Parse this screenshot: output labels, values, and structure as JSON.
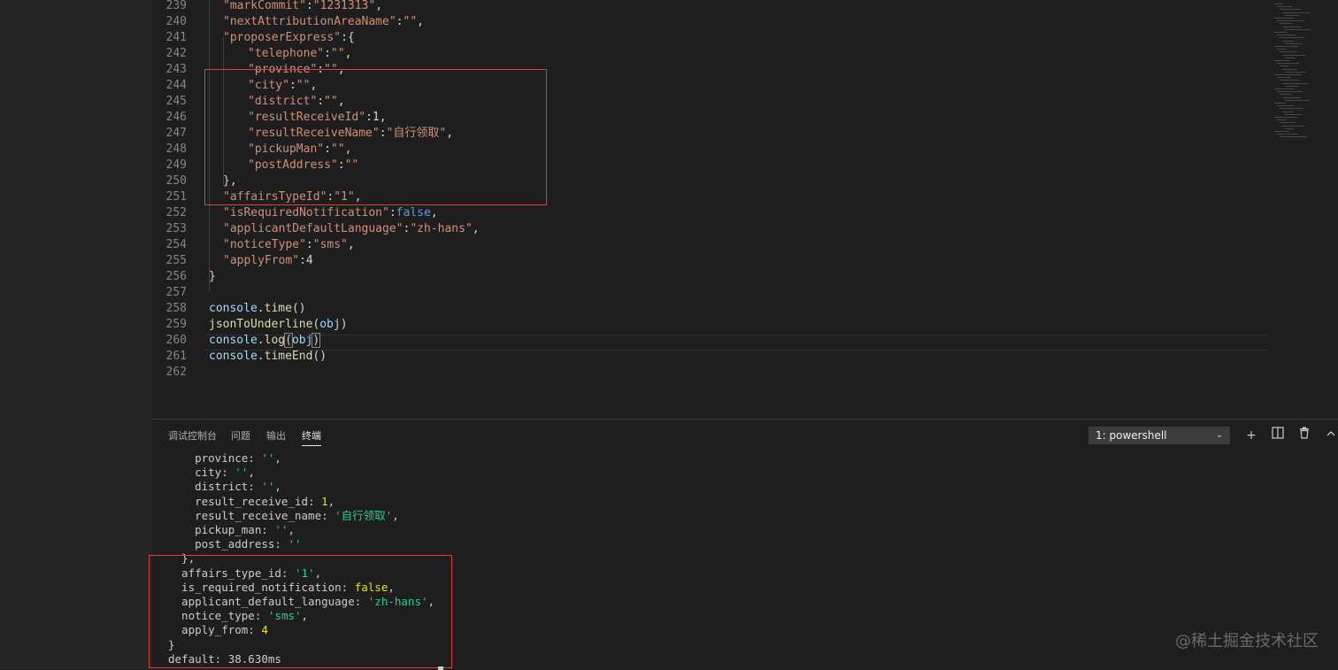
{
  "editor": {
    "lines": [
      {
        "num": "239",
        "tokens": [
          [
            "k",
            "\"markCommit\""
          ],
          [
            "p",
            ":"
          ],
          [
            "k",
            "\"1231313\""
          ],
          [
            "p",
            ","
          ]
        ]
      },
      {
        "num": "240",
        "tokens": [
          [
            "k",
            "\"nextAttributionAreaName\""
          ],
          [
            "p",
            ":"
          ],
          [
            "k",
            "\"\""
          ],
          [
            "p",
            ","
          ]
        ]
      },
      {
        "num": "241",
        "tokens": [
          [
            "k",
            "\"proposerExpress\""
          ],
          [
            "p",
            ":{"
          ]
        ]
      },
      {
        "num": "242",
        "tokens": [
          [
            "k",
            "\"telephone\""
          ],
          [
            "p",
            ":"
          ],
          [
            "k",
            "\"\""
          ],
          [
            "p",
            ","
          ]
        ]
      },
      {
        "num": "243",
        "tokens": [
          [
            "k",
            "\"province\""
          ],
          [
            "p",
            ":"
          ],
          [
            "k",
            "\"\""
          ],
          [
            "p",
            ","
          ]
        ]
      },
      {
        "num": "244",
        "tokens": [
          [
            "k",
            "\"city\""
          ],
          [
            "p",
            ":"
          ],
          [
            "k",
            "\"\""
          ],
          [
            "p",
            ","
          ]
        ]
      },
      {
        "num": "245",
        "tokens": [
          [
            "k",
            "\"district\""
          ],
          [
            "p",
            ":"
          ],
          [
            "k",
            "\"\""
          ],
          [
            "p",
            ","
          ]
        ]
      },
      {
        "num": "246",
        "tokens": [
          [
            "k",
            "\"resultReceiveId\""
          ],
          [
            "p",
            ":1,"
          ]
        ]
      },
      {
        "num": "247",
        "tokens": [
          [
            "k",
            "\"resultReceiveName\""
          ],
          [
            "p",
            ":"
          ],
          [
            "k",
            "\"自行领取\""
          ],
          [
            "p",
            ","
          ]
        ]
      },
      {
        "num": "248",
        "tokens": [
          [
            "k",
            "\"pickupMan\""
          ],
          [
            "p",
            ":"
          ],
          [
            "k",
            "\"\""
          ],
          [
            "p",
            ","
          ]
        ]
      },
      {
        "num": "249",
        "tokens": [
          [
            "k",
            "\"postAddress\""
          ],
          [
            "p",
            ":"
          ],
          [
            "k",
            "\"\""
          ]
        ]
      },
      {
        "num": "250",
        "tokens": [
          [
            "p",
            "},"
          ]
        ]
      },
      {
        "num": "251",
        "tokens": [
          [
            "k",
            "\"affairsTypeId\""
          ],
          [
            "p",
            ":"
          ],
          [
            "k",
            "\"1\""
          ],
          [
            "p",
            ","
          ]
        ]
      },
      {
        "num": "252",
        "tokens": [
          [
            "k",
            "\"isRequiredNotification\""
          ],
          [
            "p",
            ":"
          ],
          [
            "b",
            "false"
          ],
          [
            "p",
            ","
          ]
        ]
      },
      {
        "num": "253",
        "tokens": [
          [
            "k",
            "\"applicantDefaultLanguage\""
          ],
          [
            "p",
            ":"
          ],
          [
            "k",
            "\"zh-hans\""
          ],
          [
            "p",
            ","
          ]
        ]
      },
      {
        "num": "254",
        "tokens": [
          [
            "k",
            "\"noticeType\""
          ],
          [
            "p",
            ":"
          ],
          [
            "k",
            "\"sms\""
          ],
          [
            "p",
            ","
          ]
        ]
      },
      {
        "num": "255",
        "tokens": [
          [
            "k",
            "\"applyFrom\""
          ],
          [
            "p",
            ":4"
          ]
        ]
      },
      {
        "num": "256",
        "tokens": [
          [
            "p",
            "}"
          ]
        ]
      },
      {
        "num": "257",
        "tokens": []
      },
      {
        "num": "258",
        "tokens": [
          [
            "v",
            "console"
          ],
          [
            "p",
            "."
          ],
          [
            "f",
            "time"
          ],
          [
            "p",
            "()"
          ]
        ]
      },
      {
        "num": "259",
        "tokens": [
          [
            "f",
            "jsonToUnderline"
          ],
          [
            "p",
            "("
          ],
          [
            "v",
            "obj"
          ],
          [
            "p",
            ")"
          ]
        ]
      },
      {
        "num": "260",
        "tokens": [
          [
            "v",
            "console"
          ],
          [
            "p",
            "."
          ],
          [
            "f",
            "log"
          ],
          [
            "p",
            "("
          ],
          [
            "v",
            "obj"
          ],
          [
            "p",
            ")"
          ]
        ]
      },
      {
        "num": "261",
        "tokens": [
          [
            "v",
            "console"
          ],
          [
            "p",
            "."
          ],
          [
            "f",
            "timeEnd"
          ],
          [
            "p",
            "()"
          ]
        ]
      },
      {
        "num": "262",
        "tokens": []
      }
    ]
  },
  "panel": {
    "tabs": [
      "调试控制台",
      "问题",
      "输出",
      "终端"
    ],
    "active_tab": "终端",
    "terminal_select": "1: powershell",
    "tools": {
      "add": "+",
      "split": "◫",
      "trash": "🗑",
      "collapse": "︿"
    }
  },
  "terminal": {
    "lines": [
      {
        "tokens": [
          [
            "t",
            "    province: "
          ],
          [
            "ts",
            "''"
          ],
          [
            "t",
            ","
          ]
        ]
      },
      {
        "tokens": [
          [
            "t",
            "    city: "
          ],
          [
            "ts",
            "''"
          ],
          [
            "t",
            ","
          ]
        ]
      },
      {
        "tokens": [
          [
            "t",
            "    district: "
          ],
          [
            "ts",
            "''"
          ],
          [
            "t",
            ","
          ]
        ]
      },
      {
        "tokens": [
          [
            "t",
            "    result_receive_id: "
          ],
          [
            "tn",
            "1"
          ],
          [
            "t",
            ","
          ]
        ]
      },
      {
        "tokens": [
          [
            "t",
            "    result_receive_name: "
          ],
          [
            "ts",
            "'自行领取'"
          ],
          [
            "t",
            ","
          ]
        ]
      },
      {
        "tokens": [
          [
            "t",
            "    pickup_man: "
          ],
          [
            "ts",
            "''"
          ],
          [
            "t",
            ","
          ]
        ]
      },
      {
        "tokens": [
          [
            "t",
            "    post_address: "
          ],
          [
            "ts",
            "''"
          ]
        ]
      },
      {
        "tokens": [
          [
            "t",
            "  },"
          ]
        ]
      },
      {
        "tokens": [
          [
            "t",
            "  affairs_type_id: "
          ],
          [
            "ts",
            "'1'"
          ],
          [
            "t",
            ","
          ]
        ]
      },
      {
        "tokens": [
          [
            "t",
            "  is_required_notification: "
          ],
          [
            "tn",
            "false"
          ],
          [
            "t",
            ","
          ]
        ]
      },
      {
        "tokens": [
          [
            "t",
            "  applicant_default_language: "
          ],
          [
            "ts",
            "'zh-hans'"
          ],
          [
            "t",
            ","
          ]
        ]
      },
      {
        "tokens": [
          [
            "t",
            "  notice_type: "
          ],
          [
            "ts",
            "'sms'"
          ],
          [
            "t",
            ","
          ]
        ]
      },
      {
        "tokens": [
          [
            "t",
            "  apply_from: "
          ],
          [
            "tn",
            "4"
          ]
        ]
      },
      {
        "tokens": [
          [
            "t",
            "}"
          ]
        ]
      },
      {
        "tokens": [
          [
            "t",
            "default: 38.630ms"
          ]
        ]
      }
    ]
  },
  "watermark": "@稀土掘金技术社区"
}
